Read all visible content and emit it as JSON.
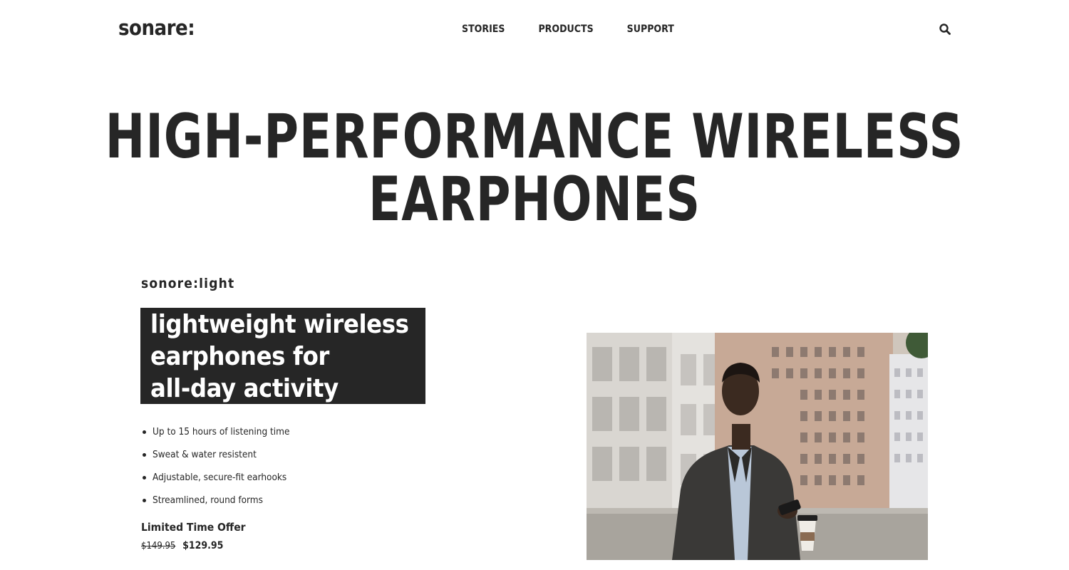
{
  "brand": {
    "logo": "sonare:"
  },
  "nav": {
    "items": [
      {
        "label": "STORIES"
      },
      {
        "label": "PRODUCTS"
      },
      {
        "label": "SUPPORT"
      }
    ],
    "search_icon": "search-icon"
  },
  "hero": {
    "title": "HIGH-PERFORMANCE WIRELESS EARPHONES"
  },
  "product": {
    "name": "sonore:light",
    "tagline_lines": [
      "lightweight wireless",
      "earphones for",
      "all-day activity"
    ],
    "features": [
      "Up to 15 hours of listening time",
      "Sweat & water resistent",
      "Adjustable, secure-fit earhooks",
      "Streamlined, round forms"
    ],
    "offer_label": "Limited Time Offer",
    "old_price": "$149.95",
    "new_price": "$129.95"
  },
  "colors": {
    "text": "#262626",
    "tagline_bg": "#262626",
    "background": "#ffffff"
  }
}
